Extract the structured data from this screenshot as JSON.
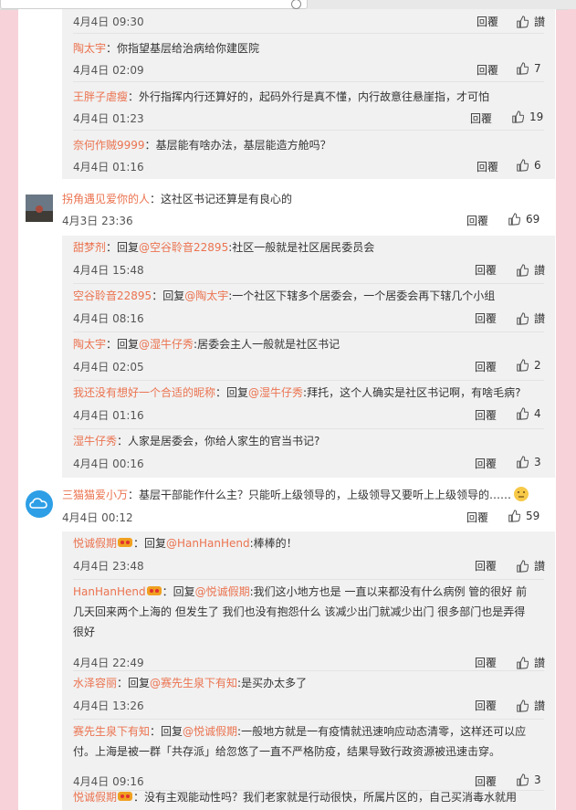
{
  "labels": {
    "reply": "回覆",
    "like_placeholder": "讃"
  },
  "group1": [
    {
      "time": "4月4日 09:30",
      "likes": ""
    },
    {
      "user": "陶太宇",
      "sep": "：",
      "text": "你指望基层给治病给你建医院",
      "time": "4月4日 02:09",
      "likes": "7"
    },
    {
      "user": "王胖子虐瘦",
      "sep": "：",
      "text": "外行指挥内行还算好的，起码外行是真不懂，内行故意往悬崖指，才可怕",
      "time": "4月4日 01:23",
      "likes": "19"
    },
    {
      "user": "奈何作贼9999",
      "sep": "：",
      "text": "基层能有啥办法，基层能造方舱吗？",
      "time": "4月4日 01:16",
      "likes": "6"
    }
  ],
  "comment1": {
    "user": "拐角遇见爱你的人",
    "sep": "：",
    "text": "这社区书记还算是有良心的",
    "time": "4月3日 23:36",
    "likes": "69"
  },
  "group2": [
    {
      "user": "甜梦剂",
      "pre": "：回复",
      "mention": "@空谷聆音22895",
      "text": ":社区一般就是社区居民委员会",
      "time": "4月4日 15:48",
      "likes": ""
    },
    {
      "user": "空谷聆音22895",
      "pre": "：回复",
      "mention": "@陶太宇",
      "text": ":一个社区下辖多个居委会，一个居委会再下辖几个小组",
      "time": "4月4日 08:16",
      "likes": ""
    },
    {
      "user": "陶太宇",
      "pre": "：回复",
      "mention": "@湿牛仔秀",
      "text": ":居委会主人一般就是社区书记",
      "time": "4月4日 02:05",
      "likes": "2"
    },
    {
      "user": "我还没有想好一个合适的昵称",
      "pre": "：回复",
      "mention": "@湿牛仔秀",
      "text": ":拜托，这个人确实是社区书记啊，有啥毛病?",
      "time": "4月4日 01:16",
      "likes": "4"
    },
    {
      "user": "湿牛仔秀",
      "pre": "：",
      "mention": "",
      "text": "人家是居委会，你给人家生的官当书记?",
      "time": "4月4日 00:16",
      "likes": "3"
    }
  ],
  "comment2": {
    "user": "三猫猫爱小万",
    "sep": "：",
    "text": "基层干部能作什么主？只能听上级领导的，上级领导又要听上上级领导的……",
    "time": "4月4日 00:12",
    "likes": "59"
  },
  "group3": [
    {
      "user": "悦诚假期",
      "badge": true,
      "pre": "：回复",
      "mention": "@HanHanHend",
      "text": ":棒棒的！",
      "time": "4月4日 23:48",
      "likes": ""
    },
    {
      "user": "HanHanHend",
      "badge": true,
      "pre": "：回复",
      "mention": "@悦诚假期",
      "text": ":我们这小地方也是 一直以来都没有什么病例 管的很好 前几天回来两个上海的 但发生了 我们也没有抱怨什么 该减少出门就减少出门 很多部门也是弄得很好",
      "time": "4月4日 22:49",
      "likes": ""
    },
    {
      "user": "水泽容丽",
      "badge": false,
      "pre": "：回复",
      "mention": "@赛先生泉下有知",
      "text": ":是买办太多了",
      "time": "4月4日 13:26",
      "likes": ""
    },
    {
      "user": "赛先生泉下有知",
      "badge": false,
      "pre": "：回复",
      "mention": "@悦诚假期",
      "text": ":一般地方就是一有疫情就迅速响应动态清零，这样还可以应付。上海是被一群「共存派」给忽悠了一直不严格防疫，结果导致行政资源被迅速击穿。",
      "time": "4月4日 09:16",
      "likes": "3"
    },
    {
      "user": "悦诚假期",
      "badge": true,
      "pre": "：",
      "mention": "",
      "text": "没有主观能动性吗？我们老家就是行动很快，所属片区的，自己买消毒水就用",
      "time": "",
      "likes": ""
    }
  ]
}
